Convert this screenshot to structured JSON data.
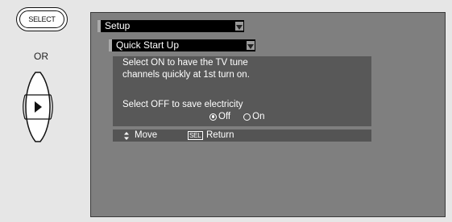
{
  "left_panel": {
    "select_button_label": "SELECT",
    "or_label": "OR",
    "rocker_icon": "right-arrow-rocker-icon"
  },
  "menu": {
    "setup_title": "Setup",
    "submenu_title": "Quick Start Up",
    "description_line1": "Select ON to have the TV tune",
    "description_line2": "channels quickly at 1st turn on.",
    "description_line3": "Select OFF to save electricity",
    "options": [
      {
        "label": "Off",
        "selected": true
      },
      {
        "label": "On",
        "selected": false
      }
    ]
  },
  "nav": {
    "move_label": "Move",
    "sel_key": "SEL",
    "return_label": "Return"
  },
  "colors": {
    "screen_bg": "#7f7f7f",
    "panel_bg": "#585858",
    "menu_bar_bg": "#000000",
    "page_bg": "#e6e6e6"
  }
}
